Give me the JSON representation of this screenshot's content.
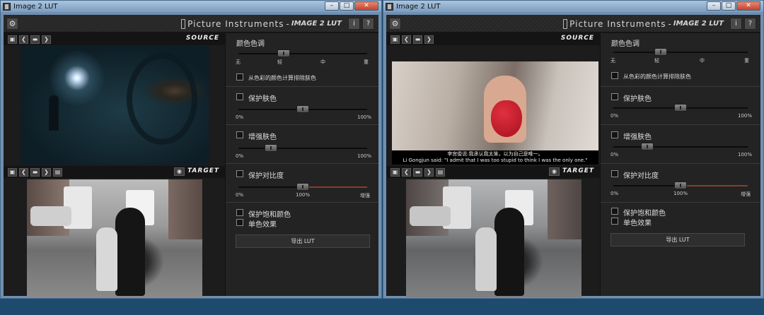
{
  "windows": [
    {
      "title": "Image 2 LUT",
      "brand": "Picture Instruments",
      "separator": "-",
      "product": "IMAGE 2 LUT",
      "buttons": {
        "settings": "⚙",
        "info": "i",
        "help": "?"
      },
      "source": {
        "label": "SOURCE",
        "subtitle_cn": "",
        "subtitle_en": ""
      },
      "target": {
        "label": "TARGET"
      }
    },
    {
      "title": "Image 2 LUT",
      "brand": "Picture Instruments",
      "separator": "-",
      "product": "IMAGE 2 LUT",
      "buttons": {
        "settings": "⚙",
        "info": "i",
        "help": "?"
      },
      "source": {
        "label": "SOURCE",
        "subtitle_cn": "李宫俊说:我承认我太笨，以为自己是唯一。",
        "subtitle_en": "Li Gongjun said: \"I admit that I was too stupid to think I was the only one.\""
      },
      "target": {
        "label": "TARGET"
      }
    }
  ],
  "window_buttons": {
    "minimize": "–",
    "maximize": "□",
    "close": "✕"
  },
  "toolbar_icons": {
    "save": "▣",
    "prev": "❮",
    "folder": "▬",
    "next": "❯",
    "export_image": "▤",
    "eye": "◉"
  },
  "panel": {
    "color_tone": {
      "title": "颜色色调",
      "ticks": [
        "无",
        "轻",
        "中",
        "重"
      ],
      "level": 0.35
    },
    "exclude_skin": {
      "label": "从色彩的颜色计算排除肤色",
      "checked": false
    },
    "protect_skin": {
      "label": "保护肤色",
      "checked": false,
      "min": "0%",
      "max": "100%",
      "level": 0.5
    },
    "enhance_skin": {
      "label": "增强肤色",
      "checked": false,
      "min": "0%",
      "max": "100%",
      "level": 0.25
    },
    "protect_contrast": {
      "label": "保护对比度",
      "checked": false,
      "min": "0%",
      "mid": "100%",
      "max": "增强",
      "level": 0.5
    },
    "protect_saturation": {
      "label": "保护饱和颜色",
      "checked": false
    },
    "mono": {
      "label": "单色效果",
      "checked": false
    },
    "export_label": "导出 LUT"
  },
  "colors": {
    "accent_fill": "#8a3c2a",
    "panel_bg": "#232323",
    "app_bg": "#181818"
  }
}
